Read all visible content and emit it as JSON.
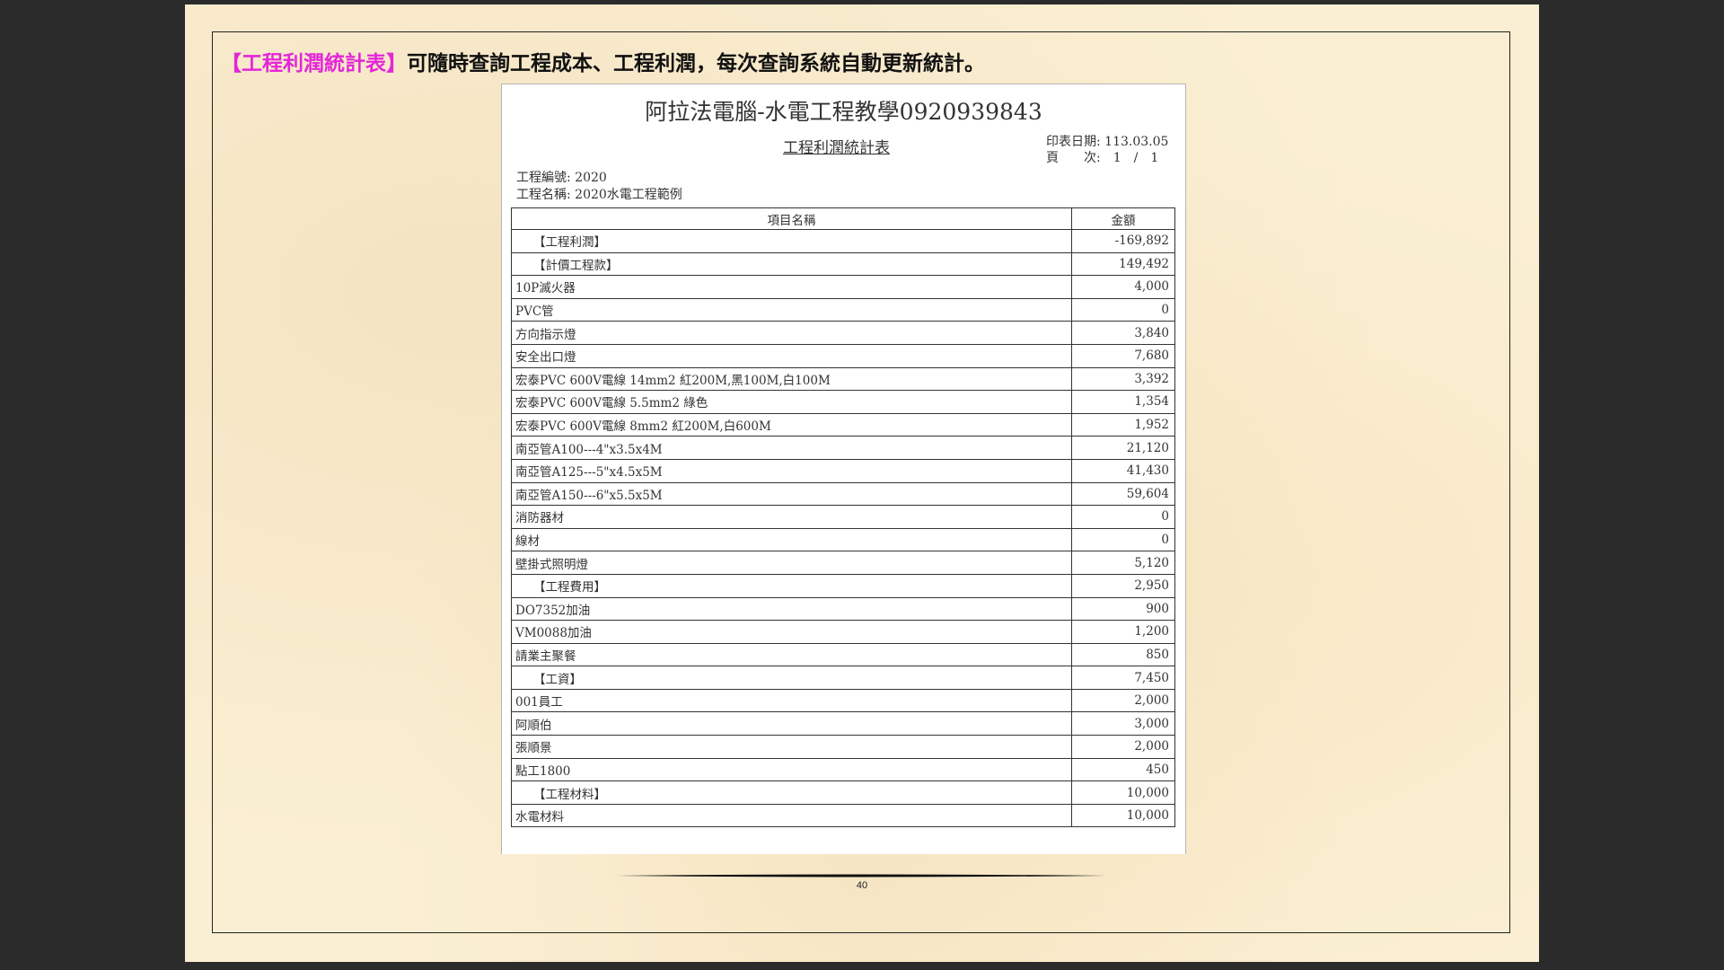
{
  "heading": {
    "highlight": "【工程利潤統計表】",
    "text": "可隨時查詢工程成本、工程利潤，每次查詢系統自動更新統計。"
  },
  "report": {
    "company": "阿拉法電腦-水電工程教學0920939843",
    "title": "工程利潤統計表",
    "print_date": "印表日期: 113.03.05",
    "page": "頁　　次:　1　/　1",
    "project_no": "工程編號: 2020",
    "project_name": "工程名稱: 2020水電工程範例",
    "columns": [
      "項目名稱",
      "金額"
    ],
    "rows": [
      {
        "name": "【工程利潤】",
        "amount": "-169,892",
        "category": true
      },
      {
        "name": "【計價工程款】",
        "amount": "149,492",
        "category": true
      },
      {
        "name": "10P滅火器",
        "amount": "4,000",
        "category": false
      },
      {
        "name": "PVC管",
        "amount": "0",
        "category": false
      },
      {
        "name": "方向指示燈",
        "amount": "3,840",
        "category": false
      },
      {
        "name": "安全出口燈",
        "amount": "7,680",
        "category": false
      },
      {
        "name": "宏泰PVC 600V電線 14mm2 紅200M,黑100M,白100M",
        "amount": "3,392",
        "category": false
      },
      {
        "name": "宏泰PVC 600V電線 5.5mm2 綠色",
        "amount": "1,354",
        "category": false
      },
      {
        "name": "宏泰PVC 600V電線 8mm2 紅200M,白600M",
        "amount": "1,952",
        "category": false
      },
      {
        "name": "南亞管A100---4\"x3.5x4M",
        "amount": "21,120",
        "category": false
      },
      {
        "name": "南亞管A125---5\"x4.5x5M",
        "amount": "41,430",
        "category": false
      },
      {
        "name": "南亞管A150---6\"x5.5x5M",
        "amount": "59,604",
        "category": false
      },
      {
        "name": "消防器材",
        "amount": "0",
        "category": false
      },
      {
        "name": "線材",
        "amount": "0",
        "category": false
      },
      {
        "name": "壁掛式照明燈",
        "amount": "5,120",
        "category": false
      },
      {
        "name": "【工程費用】",
        "amount": "2,950",
        "category": true
      },
      {
        "name": "DO7352加油",
        "amount": "900",
        "category": false
      },
      {
        "name": "VM0088加油",
        "amount": "1,200",
        "category": false
      },
      {
        "name": "請業主聚餐",
        "amount": "850",
        "category": false
      },
      {
        "name": "【工資】",
        "amount": "7,450",
        "category": true
      },
      {
        "name": "001員工",
        "amount": "2,000",
        "category": false
      },
      {
        "name": "阿順伯",
        "amount": "3,000",
        "category": false
      },
      {
        "name": "張順景",
        "amount": "2,000",
        "category": false
      },
      {
        "name": "點工1800",
        "amount": "450",
        "category": false
      },
      {
        "name": "【工程材料】",
        "amount": "10,000",
        "category": true
      },
      {
        "name": "水電材料",
        "amount": "10,000",
        "category": false
      }
    ]
  },
  "page_number": "40"
}
